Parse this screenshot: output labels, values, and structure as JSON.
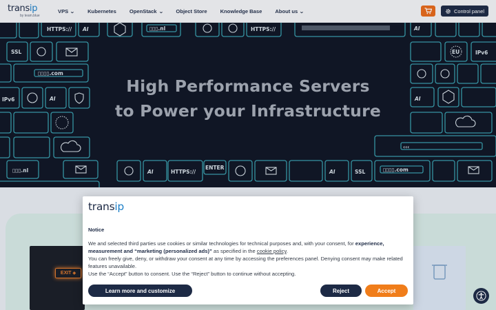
{
  "header": {
    "logo_text_main": "trans",
    "logo_text_accent": "ip",
    "logo_sub": "by team.blue",
    "nav": [
      {
        "label": "VPS",
        "has_dropdown": true
      },
      {
        "label": "Kubernetes",
        "has_dropdown": false
      },
      {
        "label": "OpenStack",
        "has_dropdown": true
      },
      {
        "label": "Object Store",
        "has_dropdown": false
      },
      {
        "label": "Knowledge Base",
        "has_dropdown": false
      },
      {
        "label": "About us",
        "has_dropdown": true
      }
    ],
    "cart_icon": "cart-icon",
    "control_panel_label": "Control panel",
    "control_panel_icon": "gear-icon"
  },
  "hero": {
    "title_line1": "High Performance Servers",
    "title_line2": "to Power your Infrastructure",
    "tile_labels": {
      "https": "HTTPS://",
      "ssl": "SSL",
      "ipv6": "IPv6",
      "eu": "EU",
      "enter": "ENTER",
      "domain_nl": "▯▯▯.nl",
      "domain_com": "▯▯▯▯.com"
    }
  },
  "content": {
    "exit_sign": "EXIT"
  },
  "cookie_modal": {
    "logo_main": "trans",
    "logo_accent": "ip",
    "title": "Notice",
    "p1_pre": "We and selected third parties use cookies or similar technologies for technical purposes and, with your consent, for ",
    "p1_bold": "experience, measurement and “marketing (personalized ads)”",
    "p1_mid": " as specified in the ",
    "p1_link": "cookie policy",
    "p1_end": ".",
    "p2": "You can freely give, deny, or withdraw your consent at any time by accessing the preferences panel. Denying consent may make related features unavailable.",
    "p3": "Use the “Accept” button to consent. Use the “Reject” button to continue without accepting.",
    "learn_more_label": "Learn more and customize",
    "reject_label": "Reject",
    "accept_label": "Accept"
  },
  "accessibility_icon": "accessibility-icon",
  "colors": {
    "brand_navy": "#1d2a45",
    "brand_blue": "#1e80c8",
    "accent_orange": "#f07d1a",
    "hero_bg": "#0f1524",
    "tile_cyan": "#3fb6c6"
  }
}
